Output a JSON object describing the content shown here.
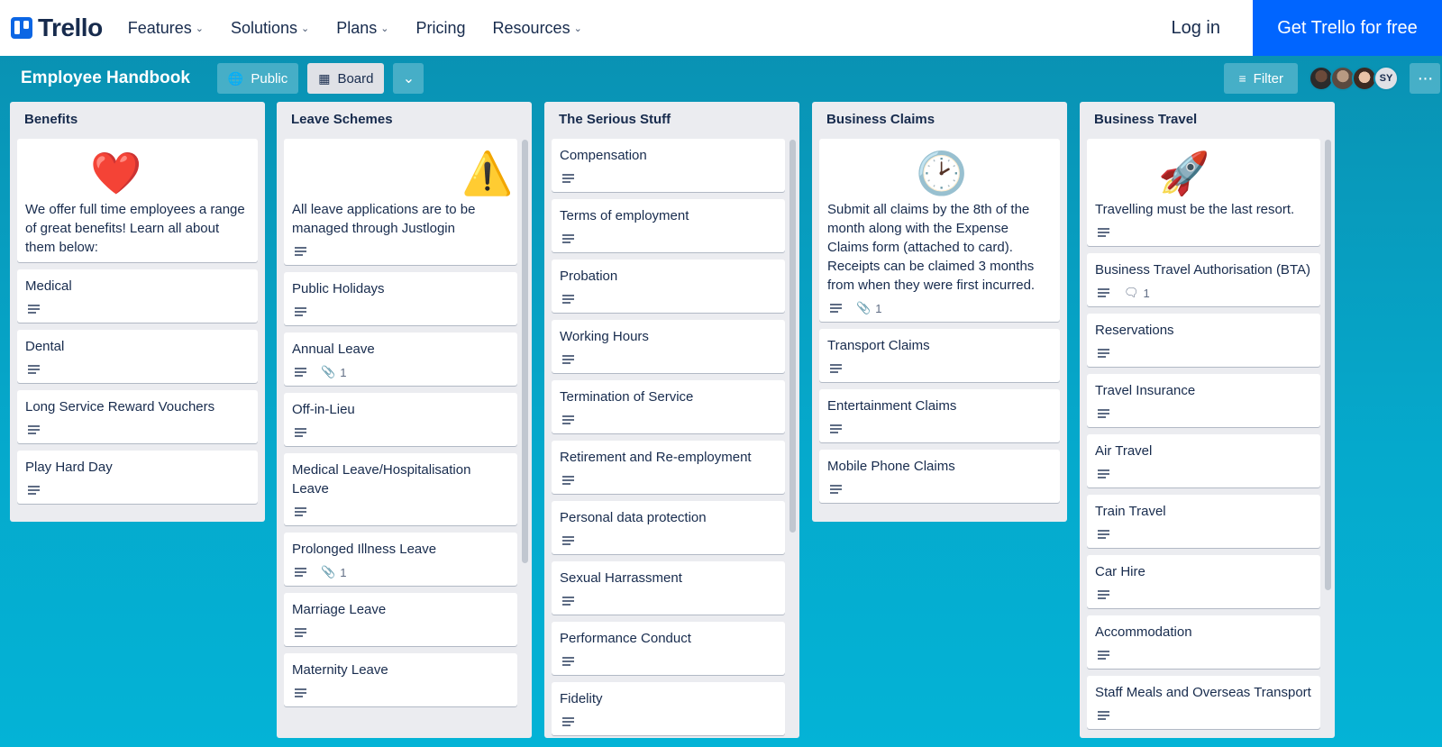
{
  "topnav": {
    "logo_text": "Trello",
    "items": [
      {
        "label": "Features",
        "has_dropdown": true
      },
      {
        "label": "Solutions",
        "has_dropdown": true
      },
      {
        "label": "Plans",
        "has_dropdown": true
      },
      {
        "label": "Pricing",
        "has_dropdown": false
      },
      {
        "label": "Resources",
        "has_dropdown": true
      }
    ],
    "login_label": "Log in",
    "cta_label": "Get Trello for free"
  },
  "board_header": {
    "title": "Employee Handbook",
    "visibility_label": "Public",
    "view_label": "Board",
    "filter_label": "Filter",
    "member_initials": "SY"
  },
  "lists": [
    {
      "title": "Benefits",
      "cards": [
        {
          "cover_icon": "heart-icon",
          "title": "We offer full time employees a range of great benefits! Learn all about them below:",
          "description": false
        },
        {
          "title": "Medical",
          "description": true
        },
        {
          "title": "Dental",
          "description": true
        },
        {
          "title": "Long Service Reward Vouchers",
          "description": true
        },
        {
          "title": "Play Hard Day",
          "description": true
        }
      ]
    },
    {
      "title": "Leave Schemes",
      "cards": [
        {
          "cover_icon": "warning-icon",
          "title": "All leave applications are to be managed through Justlogin",
          "description": true
        },
        {
          "title": "Public Holidays",
          "description": true
        },
        {
          "title": "Annual Leave",
          "description": true,
          "attachments": "1"
        },
        {
          "title": "Off-in-Lieu",
          "description": true
        },
        {
          "title": "Medical Leave/Hospitalisation Leave",
          "description": true
        },
        {
          "title": "Prolonged Illness Leave",
          "description": true,
          "attachments": "1"
        },
        {
          "title": "Marriage Leave",
          "description": true
        },
        {
          "title": "Maternity Leave",
          "description": true
        }
      ]
    },
    {
      "title": "The Serious Stuff",
      "cards": [
        {
          "title": "Compensation",
          "description": true
        },
        {
          "title": "Terms of employment",
          "description": true
        },
        {
          "title": "Probation",
          "description": true
        },
        {
          "title": "Working Hours",
          "description": true
        },
        {
          "title": "Termination of Service",
          "description": true
        },
        {
          "title": "Retirement and Re-employment",
          "description": true
        },
        {
          "title": "Personal data protection",
          "description": true
        },
        {
          "title": "Sexual Harrassment",
          "description": true
        },
        {
          "title": "Performance Conduct",
          "description": true
        },
        {
          "title": "Fidelity",
          "description": true
        }
      ]
    },
    {
      "title": "Business Claims",
      "cards": [
        {
          "cover_icon": "clock-icon",
          "title": "Submit all claims by the 8th of the month along with the Expense Claims form (attached to card). Receipts can be claimed 3 months from when they were first incurred.",
          "description": true,
          "attachments": "1"
        },
        {
          "title": "Transport Claims",
          "description": true
        },
        {
          "title": "Entertainment Claims",
          "description": true
        },
        {
          "title": "Mobile Phone Claims",
          "description": true
        }
      ]
    },
    {
      "title": "Business Travel",
      "cards": [
        {
          "cover_icon": "rocket-icon",
          "title": "Travelling must be the last resort.",
          "description": true
        },
        {
          "title": "Business Travel Authorisation (BTA)",
          "description": true,
          "comments": "1"
        },
        {
          "title": "Reservations",
          "description": true
        },
        {
          "title": "Travel Insurance",
          "description": true
        },
        {
          "title": "Air Travel",
          "description": true
        },
        {
          "title": "Train Travel",
          "description": true
        },
        {
          "title": "Car Hire",
          "description": true
        },
        {
          "title": "Accommodation",
          "description": true
        },
        {
          "title": "Staff Meals and Overseas Transport",
          "description": true
        }
      ]
    }
  ]
}
